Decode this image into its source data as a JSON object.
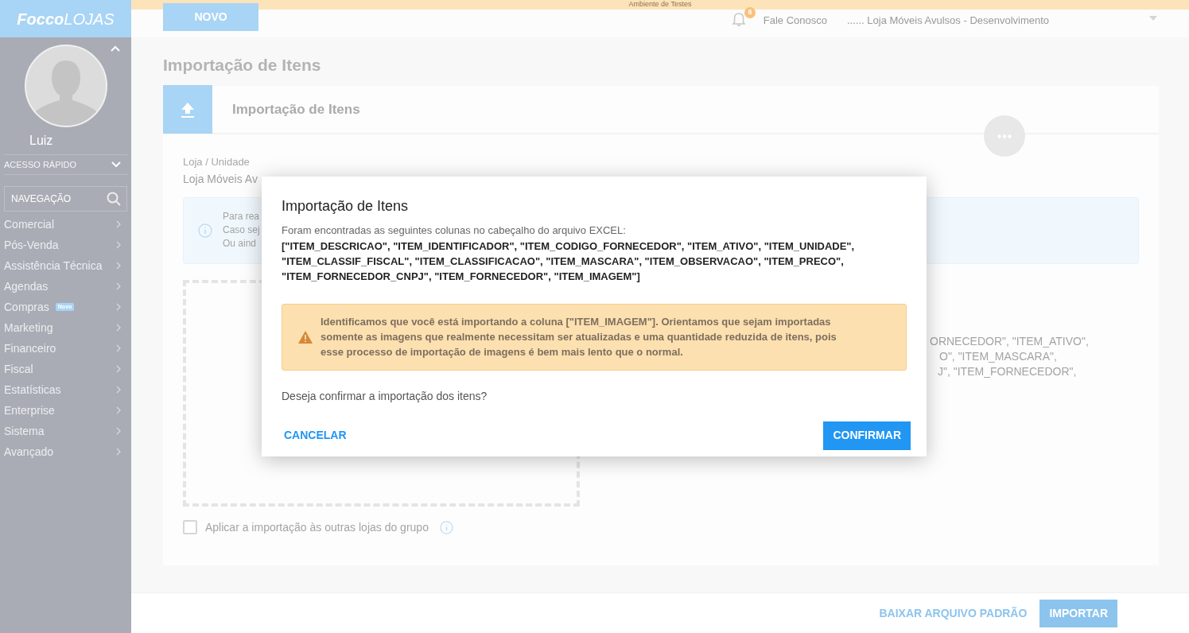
{
  "environment_banner": "Ambiente de Testes",
  "sidebar": {
    "logo_bold": "Focco",
    "logo_light": "LOJAS",
    "user_name": "Luiz",
    "quick_access": "ACESSO RÁPIDO",
    "search_placeholder": "NAVEGAÇÃO",
    "items": [
      {
        "label": "Comercial"
      },
      {
        "label": "Pós-Venda"
      },
      {
        "label": "Assistência Técnica"
      },
      {
        "label": "Agendas"
      },
      {
        "label": "Compras",
        "badge": "Novo"
      },
      {
        "label": "Marketing"
      },
      {
        "label": "Financeiro"
      },
      {
        "label": "Fiscal"
      },
      {
        "label": "Estatísticas"
      },
      {
        "label": "Enterprise"
      },
      {
        "label": "Sistema"
      },
      {
        "label": "Avançado"
      }
    ]
  },
  "header": {
    "new_button": "NOVO",
    "notifications": "6",
    "contact": "Fale Conosco",
    "store": "...... Loja Móveis Avulsos - Desenvolvimento"
  },
  "page_title": "Importação de Itens",
  "card": {
    "title": "Importação de Itens",
    "store_label": "Loja / Unidade",
    "store_value": "Loja Móveis Av",
    "info_lines": [
      "Para rea",
      "Caso sej",
      "Ou aind"
    ],
    "columns_fragments": [
      "ORNECEDOR\", \"ITEM_ATIVO\",",
      "O\", \"ITEM_MASCARA\",",
      "J\", \"ITEM_FORNECEDOR\","
    ],
    "apply_all": {
      "label": "Aplicar a importação às outras lojas do grupo",
      "checked": false
    }
  },
  "footer": {
    "download_button": "BAIXAR ARQUIVO PADRÃO",
    "import_button": "IMPORTAR"
  },
  "dialog": {
    "title": "Importação de Itens",
    "intro": "Foram encontradas as seguintes colunas no cabeçalho do arquivo EXCEL:",
    "columns": "[\"ITEM_DESCRICAO\", \"ITEM_IDENTIFICADOR\", \"ITEM_CODIGO_FORNECEDOR\", \"ITEM_ATIVO\", \"ITEM_UNIDADE\", \"ITEM_CLASSIF_FISCAL\", \"ITEM_CLASSIFICACAO\", \"ITEM_MASCARA\", \"ITEM_OBSERVACAO\", \"ITEM_PRECO\", \"ITEM_FORNECEDOR_CNPJ\", \"ITEM_FORNECEDOR\", \"ITEM_IMAGEM\"]",
    "warning": "Identificamos que você está importando a coluna **[\"ITEM_IMAGEM\"]**. Orientamos que sejam importadas somente as imagens que realmente necessitam ser atualizadas e uma quantidade reduzida de itens, pois esse processo de importação de imagens é bem mais lento que o normal.",
    "question": "Deseja confirmar a importação dos itens?",
    "cancel": "CANCELAR",
    "confirm": "CONFIRMAR"
  }
}
